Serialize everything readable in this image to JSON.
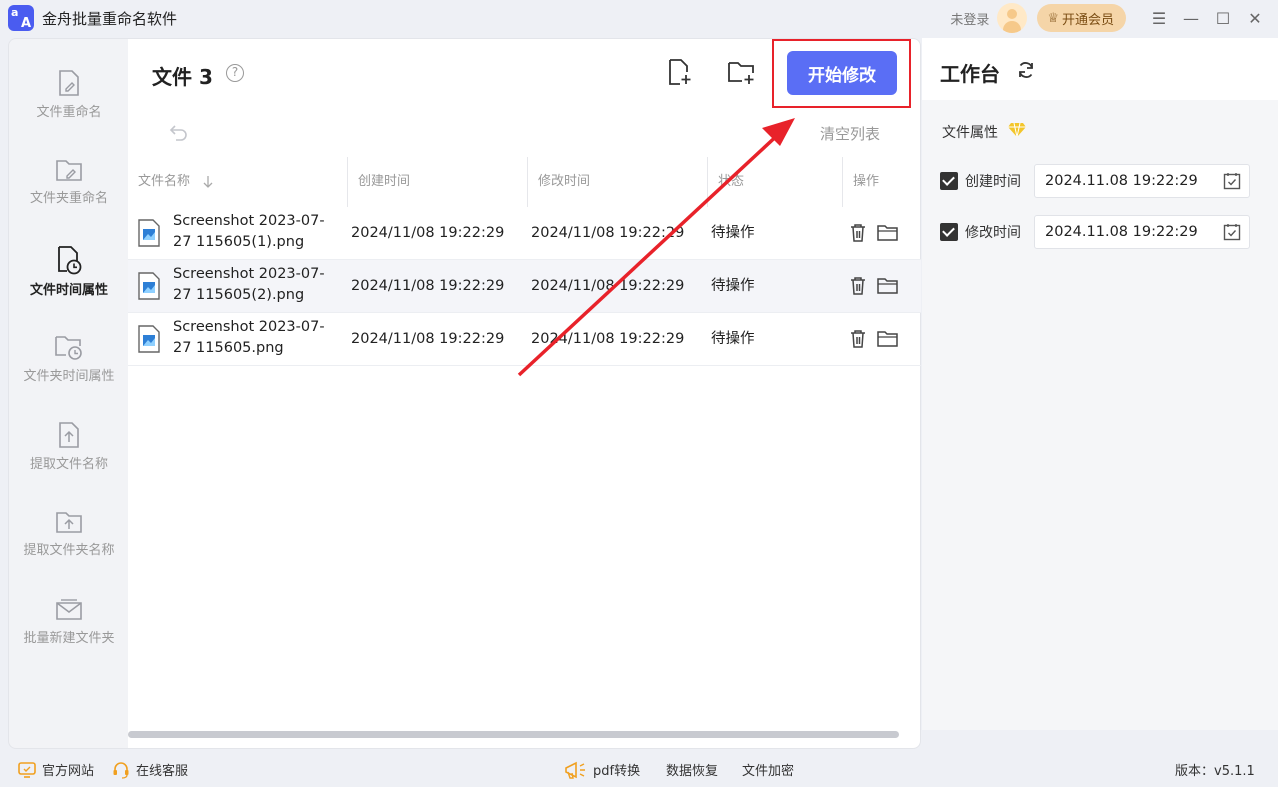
{
  "app": {
    "title": "金舟批量重命名软件",
    "login_status": "未登录",
    "vip_label": "开通会员"
  },
  "sidebar": {
    "items": [
      {
        "label": "文件重命名",
        "icon": "file-rename-icon"
      },
      {
        "label": "文件夹重命名",
        "icon": "folder-rename-icon"
      },
      {
        "label": "文件时间属性",
        "icon": "file-time-icon",
        "active": true
      },
      {
        "label": "文件夹时间属性",
        "icon": "folder-time-icon"
      },
      {
        "label": "提取文件名称",
        "icon": "extract-file-name-icon"
      },
      {
        "label": "提取文件夹名称",
        "icon": "extract-folder-name-icon"
      },
      {
        "label": "批量新建文件夹",
        "icon": "batch-new-folder-icon"
      }
    ]
  },
  "main": {
    "title": "文件 3",
    "start_button": "开始修改",
    "clear_list": "清空列表",
    "columns": [
      "文件名称",
      "创建时间",
      "修改时间",
      "状态",
      "操作"
    ],
    "rows": [
      {
        "name": "Screenshot 2023-07-27 115605(1).png",
        "created": "2024/11/08 19:22:29",
        "modified": "2024/11/08 19:22:29",
        "status": "待操作"
      },
      {
        "name": "Screenshot 2023-07-27 115605(2).png",
        "created": "2024/11/08 19:22:29",
        "modified": "2024/11/08 19:22:29",
        "status": "待操作"
      },
      {
        "name": "Screenshot 2023-07-27 115605.png",
        "created": "2024/11/08 19:22:29",
        "modified": "2024/11/08 19:22:29",
        "status": "待操作"
      }
    ]
  },
  "workbench": {
    "title": "工作台",
    "attr_title": "文件属性",
    "create_label": "创建时间",
    "create_value": "2024.11.08 19:22:29",
    "modify_label": "修改时间",
    "modify_value": "2024.11.08 19:22:29"
  },
  "footer": {
    "website": "官方网站",
    "service": "在线客服",
    "pdf": "pdf转换",
    "recovery": "数据恢复",
    "encrypt": "文件加密",
    "version": "版本：v5.1.1"
  },
  "colors": {
    "accent": "#5a6ef5",
    "annotation": "#e8222a",
    "vip": "#f5d5a8"
  }
}
